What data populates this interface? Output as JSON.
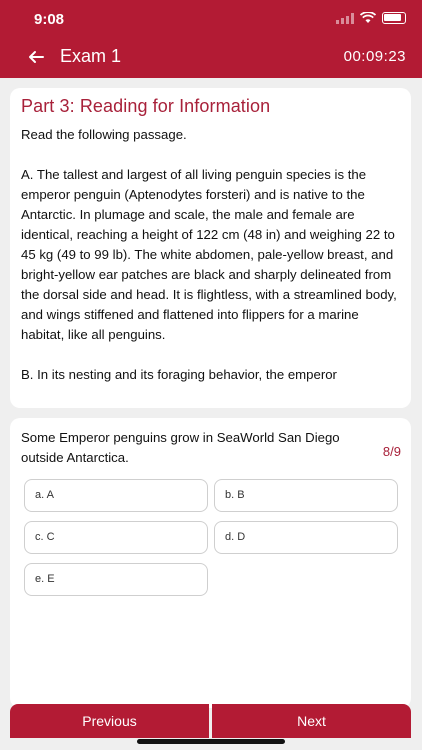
{
  "status_bar": {
    "time": "9:08"
  },
  "header": {
    "title": "Exam 1",
    "timer": "00:09:23"
  },
  "passage": {
    "title": "Part 3: Reading for Information",
    "instruction": "Read the following passage.",
    "paragraph_a": "A. The tallest and largest of all living penguin species is the emperor penguin (Aptenodytes forsteri) and is native to the Antarctic. In plumage and scale, the male and female are identical, reaching a height of 122 cm (48 in) and weighing 22 to 45 kg (49 to 99 lb). The white abdomen, pale-yellow breast, and bright-yellow ear patches are black and sharply delineated from the dorsal side and head. It is flightless, with a streamlined body, and wings stiffened and flattened into flippers for a marine habitat, like all penguins.",
    "paragraph_b": "B. In its nesting and its foraging behavior, the emperor"
  },
  "question": {
    "text": "Some Emperor penguins grow in SeaWorld San Diego outside Antarctica.",
    "counter": "8/9",
    "options": [
      {
        "label": "a. A"
      },
      {
        "label": "b. B"
      },
      {
        "label": "c. C"
      },
      {
        "label": "d. D"
      },
      {
        "label": "e. E"
      }
    ]
  },
  "footer": {
    "previous": "Previous",
    "next": "Next"
  }
}
